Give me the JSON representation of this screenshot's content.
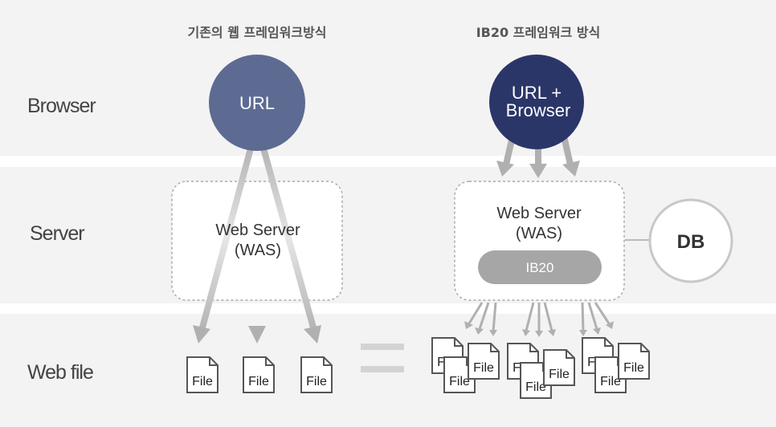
{
  "rows": {
    "browser": "Browser",
    "server": "Server",
    "webfile": "Web file"
  },
  "left": {
    "title": "기존의 웹 프레임워크방식",
    "browser_node": "URL",
    "server_line1": "Web Server",
    "server_line2": "(WAS)",
    "file_label": "File"
  },
  "right": {
    "title": "IB20 프레임워크 방식",
    "browser_line1": "URL +",
    "browser_line2": "Browser",
    "server_line1": "Web Server",
    "server_line2": "(WAS)",
    "engine": "IB20",
    "db": "DB",
    "file_label": "File"
  },
  "equals_sign": "=",
  "colors": {
    "band": "#f3f3f3",
    "left_circle": "#5d6b93",
    "right_circle": "#2b3668",
    "arrow": "#b0b0b0",
    "engine_pill": "#a6a6a6"
  }
}
